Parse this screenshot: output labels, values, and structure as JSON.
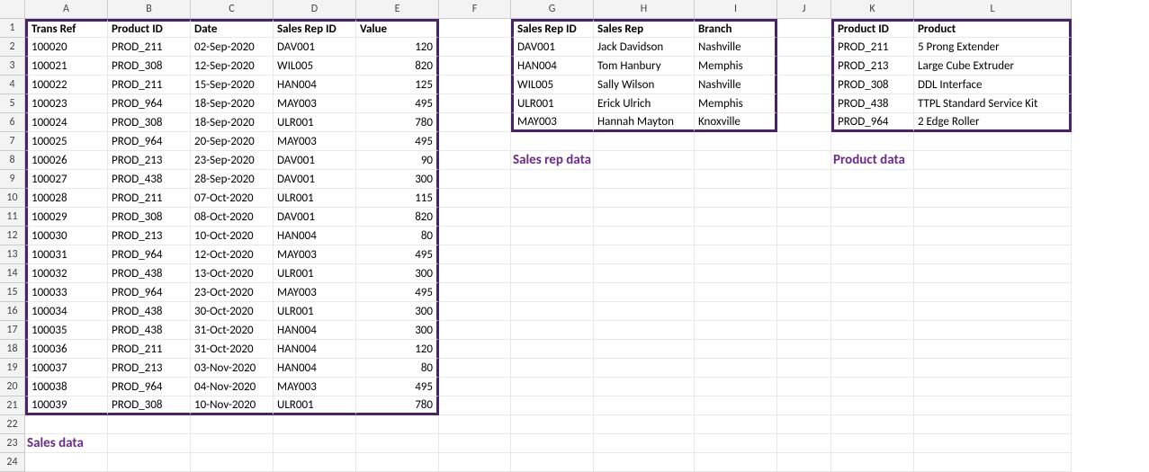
{
  "columns": [
    "A",
    "B",
    "C",
    "D",
    "E",
    "F",
    "G",
    "H",
    "I",
    "J",
    "K",
    "L"
  ],
  "rowcount": 24,
  "sales": {
    "header": {
      "trans": "Trans Ref",
      "product": "Product ID",
      "date": "Date",
      "rep": "Sales Rep ID",
      "value": "Value"
    },
    "rows": [
      {
        "trans": "100020",
        "product": "PROD_211",
        "date": "02-Sep-2020",
        "rep": "DAV001",
        "value": "120"
      },
      {
        "trans": "100021",
        "product": "PROD_308",
        "date": "12-Sep-2020",
        "rep": "WIL005",
        "value": "820"
      },
      {
        "trans": "100022",
        "product": "PROD_211",
        "date": "15-Sep-2020",
        "rep": "HAN004",
        "value": "125"
      },
      {
        "trans": "100023",
        "product": "PROD_964",
        "date": "18-Sep-2020",
        "rep": "MAY003",
        "value": "495"
      },
      {
        "trans": "100024",
        "product": "PROD_308",
        "date": "18-Sep-2020",
        "rep": "ULR001",
        "value": "780"
      },
      {
        "trans": "100025",
        "product": "PROD_964",
        "date": "20-Sep-2020",
        "rep": "MAY003",
        "value": "495"
      },
      {
        "trans": "100026",
        "product": "PROD_213",
        "date": "23-Sep-2020",
        "rep": "DAV001",
        "value": "90"
      },
      {
        "trans": "100027",
        "product": "PROD_438",
        "date": "28-Sep-2020",
        "rep": "DAV001",
        "value": "300"
      },
      {
        "trans": "100028",
        "product": "PROD_211",
        "date": "07-Oct-2020",
        "rep": "ULR001",
        "value": "115"
      },
      {
        "trans": "100029",
        "product": "PROD_308",
        "date": "08-Oct-2020",
        "rep": "DAV001",
        "value": "820"
      },
      {
        "trans": "100030",
        "product": "PROD_213",
        "date": "10-Oct-2020",
        "rep": "HAN004",
        "value": "80"
      },
      {
        "trans": "100031",
        "product": "PROD_964",
        "date": "12-Oct-2020",
        "rep": "MAY003",
        "value": "495"
      },
      {
        "trans": "100032",
        "product": "PROD_438",
        "date": "13-Oct-2020",
        "rep": "ULR001",
        "value": "300"
      },
      {
        "trans": "100033",
        "product": "PROD_964",
        "date": "23-Oct-2020",
        "rep": "MAY003",
        "value": "495"
      },
      {
        "trans": "100034",
        "product": "PROD_438",
        "date": "30-Oct-2020",
        "rep": "ULR001",
        "value": "300"
      },
      {
        "trans": "100035",
        "product": "PROD_438",
        "date": "31-Oct-2020",
        "rep": "HAN004",
        "value": "300"
      },
      {
        "trans": "100036",
        "product": "PROD_211",
        "date": "31-Oct-2020",
        "rep": "HAN004",
        "value": "120"
      },
      {
        "trans": "100037",
        "product": "PROD_213",
        "date": "03-Nov-2020",
        "rep": "HAN004",
        "value": "80"
      },
      {
        "trans": "100038",
        "product": "PROD_964",
        "date": "04-Nov-2020",
        "rep": "MAY003",
        "value": "495"
      },
      {
        "trans": "100039",
        "product": "PROD_308",
        "date": "10-Nov-2020",
        "rep": "ULR001",
        "value": "780"
      }
    ],
    "label": "Sales data"
  },
  "reps": {
    "header": {
      "id": "Sales Rep ID",
      "name": "Sales Rep",
      "branch": "Branch"
    },
    "rows": [
      {
        "id": "DAV001",
        "name": "Jack Davidson",
        "branch": "Nashville"
      },
      {
        "id": "HAN004",
        "name": "Tom Hanbury",
        "branch": "Memphis"
      },
      {
        "id": "WIL005",
        "name": "Sally Wilson",
        "branch": "Nashville"
      },
      {
        "id": "ULR001",
        "name": "Erick Ulrich",
        "branch": "Memphis"
      },
      {
        "id": "MAY003",
        "name": "Hannah Mayton",
        "branch": "Knoxville"
      }
    ],
    "label": "Sales rep data"
  },
  "products": {
    "header": {
      "id": "Product ID",
      "name": "Product"
    },
    "rows": [
      {
        "id": "PROD_211",
        "name": "5 Prong Extender"
      },
      {
        "id": "PROD_213",
        "name": "Large Cube Extruder"
      },
      {
        "id": "PROD_308",
        "name": "DDL Interface"
      },
      {
        "id": "PROD_438",
        "name": "TTPL Standard Service Kit"
      },
      {
        "id": "PROD_964",
        "name": "2 Edge Roller"
      }
    ],
    "label": "Product data"
  }
}
